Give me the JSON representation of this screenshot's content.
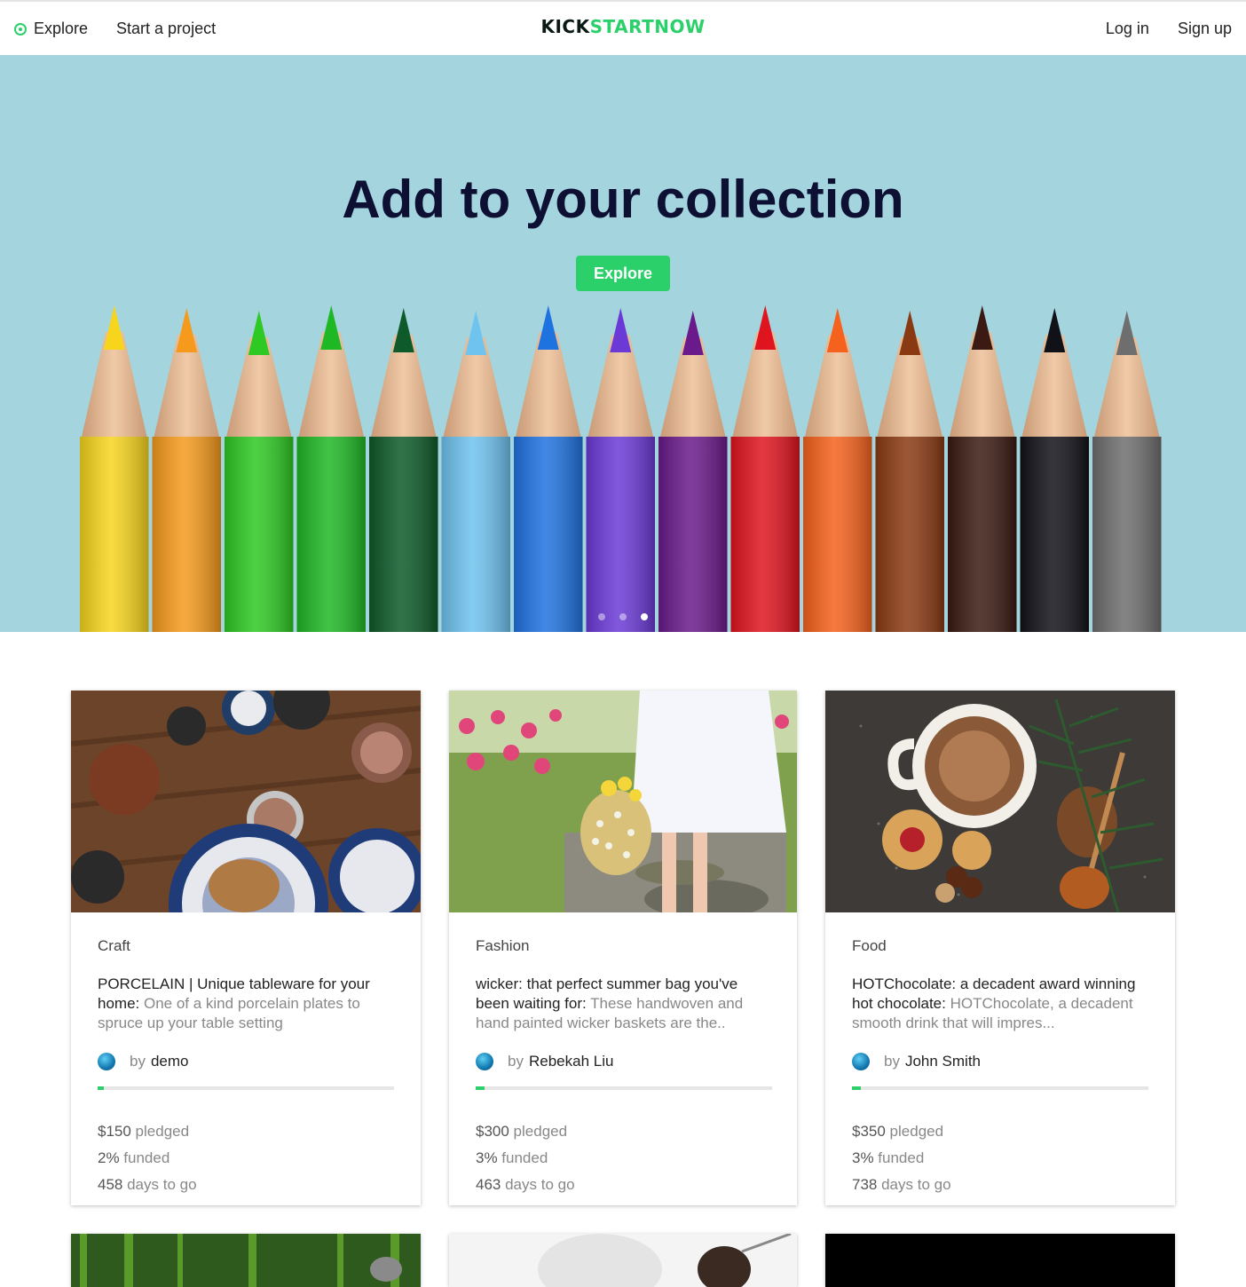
{
  "nav": {
    "explore": "Explore",
    "start_project": "Start a project",
    "logo_part1": "KICK",
    "logo_part2": "STARTNOW",
    "login": "Log in",
    "signup": "Sign up"
  },
  "hero": {
    "title": "Add to your collection",
    "button": "Explore",
    "slides": 3,
    "active_slide": 3
  },
  "cards": [
    {
      "category": "Craft",
      "title": "PORCELAIN | Unique tableware for your home:",
      "blurb": " One of a kind porcelain plates to spruce up your table setting",
      "by": "by",
      "author": "demo",
      "funded_fraction": 0.02,
      "pledged_amount": "$150",
      "pledged_label": " pledged",
      "funded_pct": "2%",
      "funded_label": " funded",
      "days": "458",
      "days_label": " days to go"
    },
    {
      "category": "Fashion",
      "title": "wicker: that perfect summer bag you've been waiting for:",
      "blurb": " These handwoven and hand painted wicker baskets are the..",
      "by": "by",
      "author": "Rebekah Liu",
      "funded_fraction": 0.03,
      "pledged_amount": "$300",
      "pledged_label": " pledged",
      "funded_pct": "3%",
      "funded_label": " funded",
      "days": "463",
      "days_label": " days to go"
    },
    {
      "category": "Food",
      "title": "HOTChocolate: a decadent award winning hot chocolate:",
      "blurb": " HOTChocolate, a decadent smooth drink that will impres...",
      "by": "by",
      "author": "John Smith",
      "funded_fraction": 0.03,
      "pledged_amount": "$350",
      "pledged_label": " pledged",
      "funded_pct": "3%",
      "funded_label": " funded",
      "days": "738",
      "days_label": " days to go"
    }
  ],
  "colors": {
    "accent": "#2bd06b",
    "hero_bg": "#a4d5df",
    "hero_title": "#0d1033"
  }
}
